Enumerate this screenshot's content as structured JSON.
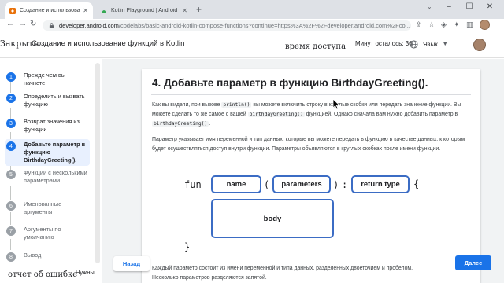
{
  "browser": {
    "tabs": [
      {
        "title": "Создание и использование фу",
        "active": true
      },
      {
        "title": "Kotlin Playground | Android De",
        "active": false
      }
    ],
    "new_tab_symbol": "+",
    "url_host": "developer.android.com",
    "url_rest": "/codelabs/basic-android-kotlin-compose-functions?continue=https%3A%2F%2Fdeveloper.android.com%2Fco...",
    "accent": "#1a73e8"
  },
  "header": {
    "close_label": "Закрыть",
    "title": "Создание и использование функций в Kotlin",
    "access_time": "время доступа",
    "timer": "Минут осталось: 36",
    "language_label": "Язык"
  },
  "sidebar": {
    "steps": [
      {
        "num": "1",
        "label": "Прежде чем вы начнете"
      },
      {
        "num": "2",
        "label": "Определить и вызвать функцию"
      },
      {
        "num": "3",
        "label": "Возврат значения из функции"
      },
      {
        "num": "4",
        "label": "Добавьте параметр в функцию BirthdayGreeting()."
      },
      {
        "num": "5",
        "label": "Функции с несколькими параметрами"
      },
      {
        "num": "6",
        "label": "Именованные аргументы"
      },
      {
        "num": "7",
        "label": "Аргументы по умолчанию"
      },
      {
        "num": "8",
        "label": "Вывод"
      }
    ]
  },
  "content": {
    "step_title": "4. Добавьте параметр в функцию BirthdayGreeting().",
    "p1": {
      "t1": "Как вы видели, при вызове ",
      "c1": "println()",
      "t2": " вы можете включить строку в круглые скобки или передать значение функции. Вы можете сделать то же самое с вашей ",
      "c2": "birthdayGreeting()",
      "t3": " функцией. Однако сначала вам нужно добавить параметр в ",
      "c3": "birthdayGreeting()",
      "t4": "."
    },
    "p2": "Параметр указывает имя переменной и тип данных, которые вы можете передать в функцию в качестве данных, к которым будет осуществляться доступ внутри функции. Параметры объявляются в круглых скобках после имени функции.",
    "diagram": {
      "fun": "fun",
      "name": "name",
      "open_paren": "(",
      "parameters": "parameters",
      "close_paren": ")",
      "colon": ":",
      "return_type": "return type",
      "open_brace": "{",
      "body": "body",
      "close_brace": "}",
      "pill_border": "#3b6cc4"
    },
    "p3_line1": "Каждый параметр состоит из имени переменной и типа данных, разделенных двоеточием и пробелом.",
    "p3_line2": "Несколько параметров разделяются запятой."
  },
  "footer": {
    "back_label": "Назад",
    "next_label": "Далее",
    "report_label": "отчет об ошибке",
    "needs_label": "Нужны"
  }
}
